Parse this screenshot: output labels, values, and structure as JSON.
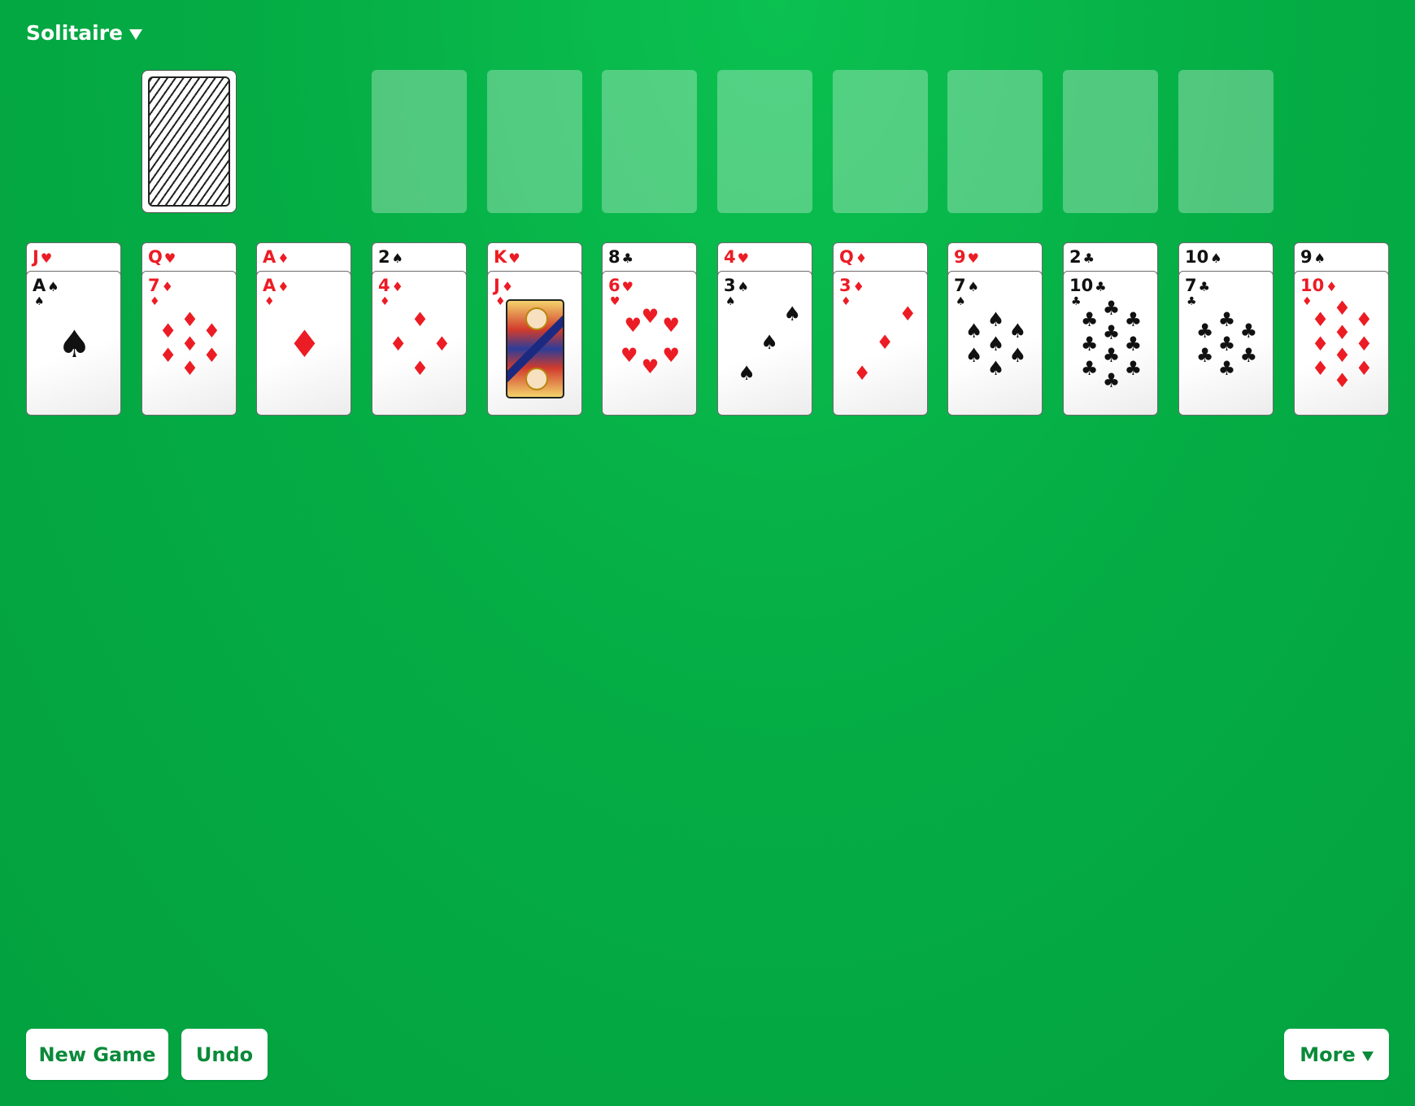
{
  "app": {
    "title": "Solitaire"
  },
  "toolbar": {
    "new_game_label": "New Game",
    "undo_label": "Undo",
    "more_label": "More"
  },
  "colors": {
    "felt": "#05ad45",
    "red_suit": "#ec1c24",
    "black_suit": "#111111",
    "button_text": "#0a8a3a"
  },
  "stock": {
    "face_down": true
  },
  "foundations": {
    "count": 8
  },
  "tableau": [
    {
      "hidden_rank": "J",
      "hidden_suit": "hearts",
      "top_rank": "A",
      "top_suit": "spades"
    },
    {
      "hidden_rank": "Q",
      "hidden_suit": "hearts",
      "top_rank": "7",
      "top_suit": "diamonds"
    },
    {
      "hidden_rank": "A",
      "hidden_suit": "diamonds",
      "top_rank": "A",
      "top_suit": "diamonds"
    },
    {
      "hidden_rank": "2",
      "hidden_suit": "spades",
      "top_rank": "4",
      "top_suit": "diamonds"
    },
    {
      "hidden_rank": "K",
      "hidden_suit": "hearts",
      "top_rank": "J",
      "top_suit": "diamonds"
    },
    {
      "hidden_rank": "8",
      "hidden_suit": "clubs",
      "top_rank": "6",
      "top_suit": "hearts"
    },
    {
      "hidden_rank": "4",
      "hidden_suit": "hearts",
      "top_rank": "3",
      "top_suit": "spades"
    },
    {
      "hidden_rank": "Q",
      "hidden_suit": "diamonds",
      "top_rank": "3",
      "top_suit": "diamonds"
    },
    {
      "hidden_rank": "9",
      "hidden_suit": "hearts",
      "top_rank": "7",
      "top_suit": "spades"
    },
    {
      "hidden_rank": "2",
      "hidden_suit": "clubs",
      "top_rank": "10",
      "top_suit": "clubs"
    },
    {
      "hidden_rank": "10",
      "hidden_suit": "spades",
      "top_rank": "7",
      "top_suit": "clubs"
    },
    {
      "hidden_rank": "9",
      "hidden_suit": "spades",
      "top_rank": "10",
      "top_suit": "diamonds"
    }
  ]
}
